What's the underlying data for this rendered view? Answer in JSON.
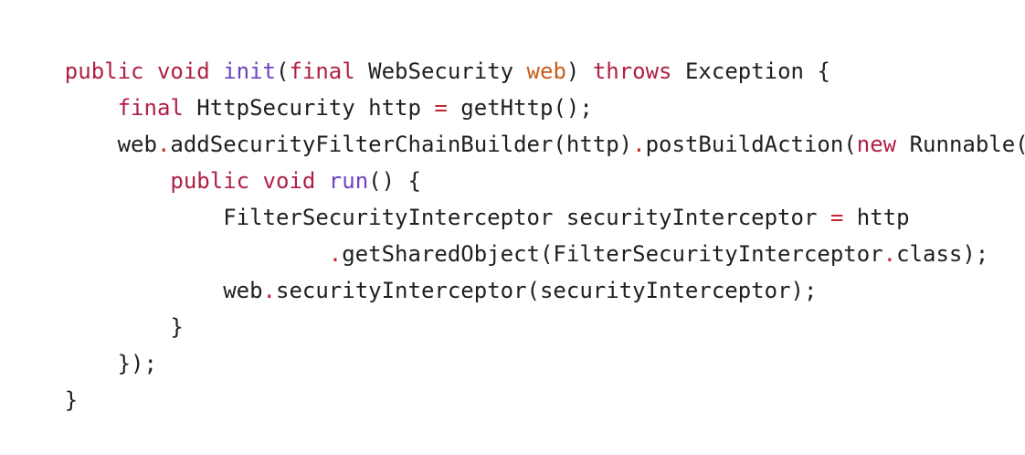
{
  "editor": {
    "theme_colors": {
      "background": "#ffffff",
      "default_text": "#1f1f1f",
      "keyword": "#b02045",
      "method": "#6f42c1",
      "parameter": "#c65d1c",
      "operator": "#c1272d"
    },
    "lines": [
      {
        "tokens": [
          {
            "text": "public",
            "kind": "keyword"
          },
          {
            "text": " ",
            "kind": "plain"
          },
          {
            "text": "void",
            "kind": "keyword"
          },
          {
            "text": " ",
            "kind": "plain"
          },
          {
            "text": "init",
            "kind": "method"
          },
          {
            "text": "(",
            "kind": "plain"
          },
          {
            "text": "final",
            "kind": "keyword"
          },
          {
            "text": " WebSecurity ",
            "kind": "plain"
          },
          {
            "text": "web",
            "kind": "parameter"
          },
          {
            "text": ") ",
            "kind": "plain"
          },
          {
            "text": "throws",
            "kind": "keyword"
          },
          {
            "text": " Exception {",
            "kind": "plain"
          }
        ]
      },
      {
        "tokens": [
          {
            "text": "    ",
            "kind": "plain"
          },
          {
            "text": "final",
            "kind": "keyword"
          },
          {
            "text": " HttpSecurity http ",
            "kind": "plain"
          },
          {
            "text": "=",
            "kind": "operator"
          },
          {
            "text": " getHttp();",
            "kind": "plain"
          }
        ]
      },
      {
        "tokens": [
          {
            "text": "    web",
            "kind": "plain"
          },
          {
            "text": ".",
            "kind": "operator"
          },
          {
            "text": "addSecurityFilterChainBuilder(http)",
            "kind": "plain"
          },
          {
            "text": ".",
            "kind": "operator"
          },
          {
            "text": "postBuildAction(",
            "kind": "plain"
          },
          {
            "text": "new",
            "kind": "keyword"
          },
          {
            "text": " Runnable() {",
            "kind": "plain"
          }
        ]
      },
      {
        "tokens": [
          {
            "text": "        ",
            "kind": "plain"
          },
          {
            "text": "public",
            "kind": "keyword"
          },
          {
            "text": " ",
            "kind": "plain"
          },
          {
            "text": "void",
            "kind": "keyword"
          },
          {
            "text": " ",
            "kind": "plain"
          },
          {
            "text": "run",
            "kind": "method"
          },
          {
            "text": "() {",
            "kind": "plain"
          }
        ]
      },
      {
        "tokens": [
          {
            "text": "            FilterSecurityInterceptor securityInterceptor ",
            "kind": "plain"
          },
          {
            "text": "=",
            "kind": "operator"
          },
          {
            "text": " http",
            "kind": "plain"
          }
        ]
      },
      {
        "tokens": [
          {
            "text": "                    ",
            "kind": "plain"
          },
          {
            "text": ".",
            "kind": "operator"
          },
          {
            "text": "getSharedObject(FilterSecurityInterceptor",
            "kind": "plain"
          },
          {
            "text": ".",
            "kind": "operator"
          },
          {
            "text": "class);",
            "kind": "plain"
          }
        ]
      },
      {
        "tokens": [
          {
            "text": "            web",
            "kind": "plain"
          },
          {
            "text": ".",
            "kind": "operator"
          },
          {
            "text": "securityInterceptor(securityInterceptor);",
            "kind": "plain"
          }
        ]
      },
      {
        "tokens": [
          {
            "text": "        }",
            "kind": "plain"
          }
        ]
      },
      {
        "tokens": [
          {
            "text": "    });",
            "kind": "plain"
          }
        ]
      },
      {
        "tokens": [
          {
            "text": "}",
            "kind": "plain"
          }
        ]
      }
    ]
  }
}
